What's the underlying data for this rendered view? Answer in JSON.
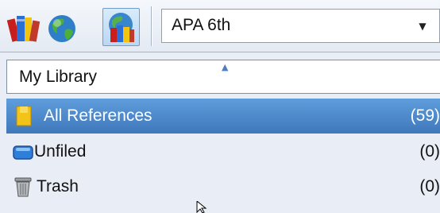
{
  "toolbar": {
    "buttons": [
      {
        "name": "local-library-mode",
        "icon": "books-icon"
      },
      {
        "name": "online-search-mode",
        "icon": "globe-icon"
      },
      {
        "name": "integrated-library-mode",
        "icon": "globe-books-icon",
        "active": true
      }
    ],
    "style_select": {
      "value": "APA 6th"
    }
  },
  "search_box": {
    "value": "My Library"
  },
  "groups": [
    {
      "label": "All References",
      "count": "(59)",
      "icon": "folder-icon",
      "selected": true
    },
    {
      "label": "Unfiled",
      "count": "(0)",
      "icon": "unfiled-icon",
      "selected": false
    },
    {
      "label": "Trash",
      "count": "(0)",
      "icon": "trash-icon",
      "selected": false
    }
  ],
  "colors": {
    "selection": "#3f78bb",
    "background": "#e9eef6"
  }
}
